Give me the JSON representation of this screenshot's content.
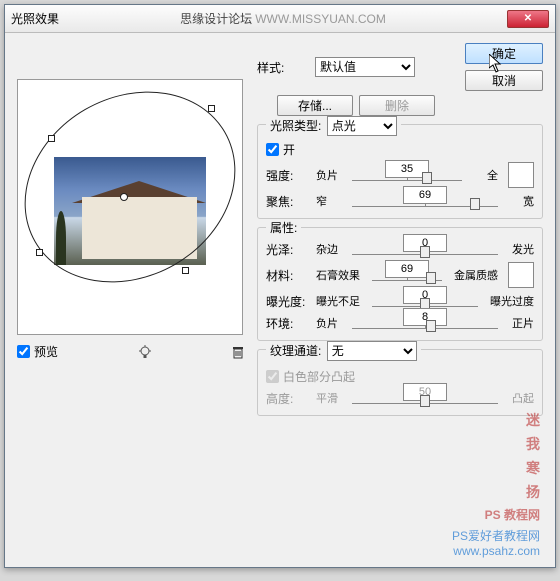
{
  "titlebar": {
    "title": "光照效果",
    "brand": "思缘设计论坛",
    "url": "WWW.MISSYUAN.COM"
  },
  "buttons": {
    "ok": "确定",
    "cancel": "取消",
    "save": "存储...",
    "delete": "删除"
  },
  "style": {
    "label": "样式:",
    "value": "默认值"
  },
  "preview": {
    "checkbox": "预览",
    "checked": true
  },
  "light_type": {
    "group": "光照类型:",
    "value": "点光",
    "on": "开",
    "on_checked": true,
    "intensity": {
      "label": "强度:",
      "left": "负片",
      "right": "全",
      "value": 35,
      "pos": 68
    },
    "focus": {
      "label": "聚焦:",
      "left": "窄",
      "right": "宽",
      "value": 69,
      "pos": 84
    }
  },
  "properties": {
    "group": "属性:",
    "gloss": {
      "label": "光泽:",
      "left": "杂边",
      "right": "发光",
      "value": 0,
      "pos": 50
    },
    "material": {
      "label": "材料:",
      "left": "石膏效果",
      "right": "金属质感",
      "value": 69,
      "pos": 84
    },
    "exposure": {
      "label": "曝光度:",
      "left": "曝光不足",
      "right": "曝光过度",
      "value": 0,
      "pos": 50
    },
    "ambience": {
      "label": "环境:",
      "left": "负片",
      "right": "正片",
      "value": 8,
      "pos": 54
    }
  },
  "texture": {
    "group": "纹理通道:",
    "value": "无",
    "white_high": "白色部分凸起",
    "white_checked": true,
    "height": {
      "label": "高度:",
      "left": "平滑",
      "right": "凸起",
      "value": 50,
      "pos": 50
    }
  },
  "watermark": {
    "l1": "迷",
    "l2": "我",
    "l3": "寒",
    "l4": "扬",
    "site1": "PS 教程网",
    "site2": "PS爱好者教程网",
    "site3": "www.psahz.com"
  }
}
